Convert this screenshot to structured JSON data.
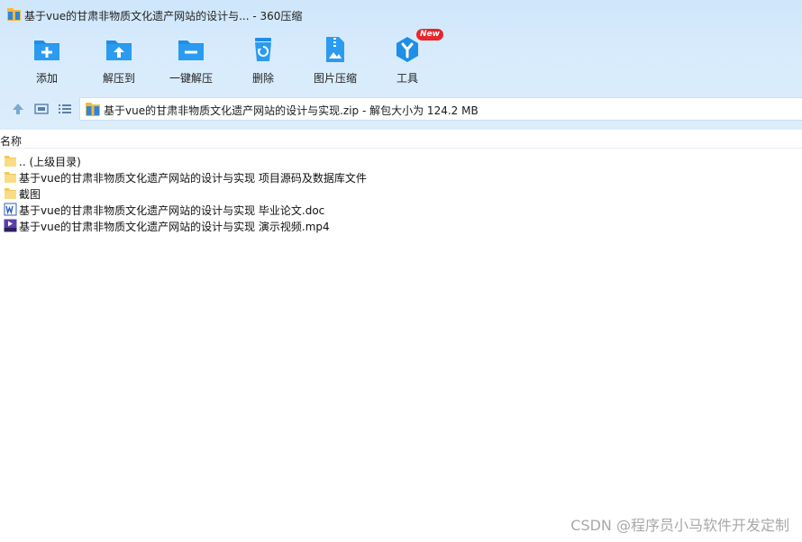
{
  "window": {
    "title": "基于vue的甘肃非物质文化遗产网站的设计与... - 360压缩"
  },
  "toolbar": {
    "items": [
      {
        "label": "添加",
        "icon": "add-folder-icon"
      },
      {
        "label": "解压到",
        "icon": "extract-to-icon"
      },
      {
        "label": "一键解压",
        "icon": "one-click-extract-icon"
      },
      {
        "label": "删除",
        "icon": "recycle-bin-icon"
      },
      {
        "label": "图片压缩",
        "icon": "image-compress-icon"
      },
      {
        "label": "工具",
        "icon": "tools-icon",
        "badge": "New"
      }
    ]
  },
  "navigation": {
    "up_icon": "up-arrow-icon",
    "view_icon": "thumbnail-view-icon",
    "list_icon": "list-view-icon"
  },
  "address": {
    "text": "基于vue的甘肃非物质文化遗产网站的设计与实现.zip - 解包大小为 124.2 MB"
  },
  "file_list": {
    "column_name": "名称",
    "items": [
      {
        "name": ".. (上级目录)",
        "type": "folder"
      },
      {
        "name": "基于vue的甘肃非物质文化遗产网站的设计与实现 项目源码及数据库文件",
        "type": "folder"
      },
      {
        "name": "截图",
        "type": "folder"
      },
      {
        "name": "基于vue的甘肃非物质文化遗产网站的设计与实现 毕业论文.doc",
        "type": "doc"
      },
      {
        "name": "基于vue的甘肃非物质文化遗产网站的设计与实现 演示视频.mp4",
        "type": "mp4"
      }
    ]
  },
  "watermark": {
    "text": "CSDN @程序员小马软件开发定制"
  },
  "colors": {
    "toolbar_bg": "#d7ebfc",
    "icon_blue": "#1f8ee6",
    "badge_red": "#e8262b",
    "folder_yellow": "#f7d36b"
  }
}
